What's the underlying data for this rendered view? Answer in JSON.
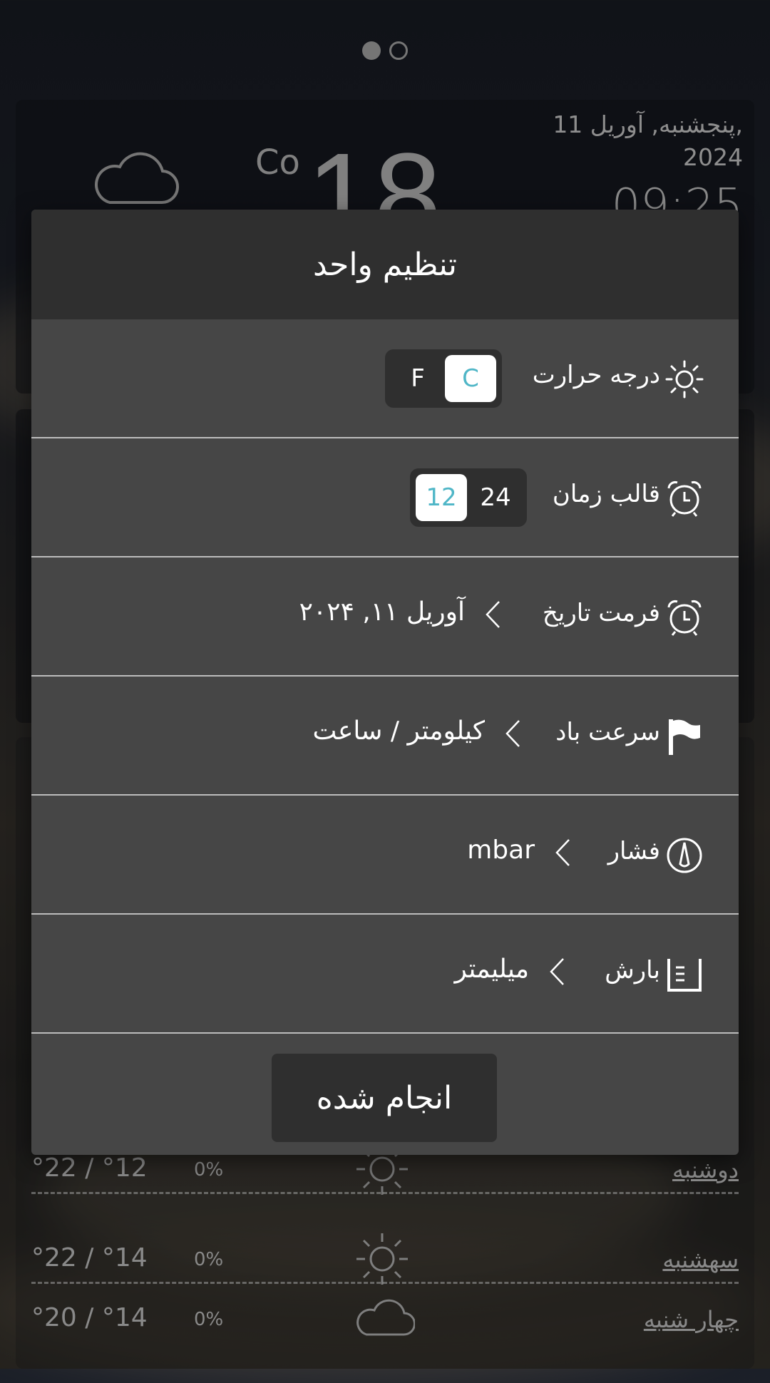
{
  "page_indicator": {
    "count": 2,
    "active_index": 0
  },
  "background_widget": {
    "date_line1": "پنجشنبه, آوریل 11,",
    "date_line2": "2024",
    "time": "09:25",
    "temperature": "18",
    "temperature_unit": "Co",
    "condition_icon": "cloud-icon"
  },
  "forecast": [
    {
      "day": "دوشنبه",
      "temps": "°22 / °12",
      "rain": "0%",
      "icon": "sun-icon"
    },
    {
      "day": "سهشنبه",
      "temps": "°22 / °14",
      "rain": "0%",
      "icon": "sun-icon"
    },
    {
      "day": "چهار شنبه",
      "temps": "°20 / °14",
      "rain": "0%",
      "icon": "cloud-icon"
    }
  ],
  "dialog": {
    "title": "تنظیم واحد",
    "rows": {
      "temperature": {
        "label": "درجه حرارت",
        "icon": "sun-icon",
        "options": [
          "C",
          "F"
        ],
        "selected": "C"
      },
      "time_format": {
        "label": "قالب زمان",
        "icon": "alarm-clock-icon",
        "options": [
          "12",
          "24"
        ],
        "selected": "12"
      },
      "date_format": {
        "label": "فرمت تاریخ",
        "icon": "alarm-clock-icon",
        "value": "آوریل ۱۱, ۲۰۲۴"
      },
      "wind_speed": {
        "label": "سرعت باد",
        "icon": "flag-icon",
        "value": "کیلومتر / ساعت"
      },
      "pressure": {
        "label": "فشار",
        "icon": "gauge-icon",
        "value": "mbar"
      },
      "precipitation": {
        "label": "بارش",
        "icon": "rain-gauge-icon",
        "value": "میلیمتر"
      }
    },
    "done_label": "انجام شده"
  },
  "colors": {
    "accent": "#4fb6c7",
    "dialog_bg": "#464646",
    "header_bg": "#2f2f2f"
  }
}
